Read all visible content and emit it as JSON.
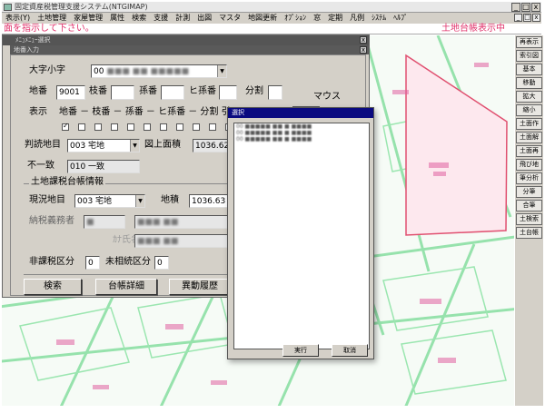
{
  "window": {
    "title": "固定資産税管理支援システム(NTGIMAP)"
  },
  "menu": [
    "表示(Y)",
    "土地管理",
    "家屋管理",
    "属性",
    "検索",
    "支援",
    "計測",
    "出図",
    "マスタ",
    "地図更新",
    "ｵﾌﾟｼｮﾝ",
    "窓",
    "定期",
    "凡例",
    "ｼｽﾃﾑ",
    "ﾍﾙﾌﾟ"
  ],
  "message": {
    "left": "面を指示して下さい。",
    "right": "土地台帳表示中"
  },
  "toolbar": [
    "再表示",
    "索引図",
    "基本",
    "移動",
    "拡大",
    "縮小",
    "土面作",
    "土面解",
    "土面再",
    "飛び地",
    "筆分析",
    "分筆",
    "合筆",
    "土検索",
    "土台帳"
  ],
  "dlg1": {
    "title1": "ﾒﾆｭﾒﾆｭｰ選択",
    "title2": "地番入力",
    "oaza_label": "大字小字",
    "oaza_value": "00",
    "chiban_label": "地番",
    "chiban_value": "9001",
    "edaban_label": "枝番",
    "magoban_label": "孫番",
    "hiban_label": "ヒ孫番",
    "bunkatsu_label": "分割",
    "mouse_label": "マウス",
    "hyoji_label": "表示",
    "hyoji_text": "地番 － 枝番 － 孫番 － ヒ孫番 － 分割 引",
    "hantei_label": "判読地目",
    "hantei_value": "003 宅地",
    "zujo_label": "図上面積",
    "zujo_value": "1036.62",
    "fuicchi_label": "不一致",
    "fuicchi_value": "010 一致",
    "group_label": "土地課税台帳情報",
    "genkyo_label": "現況地目",
    "genkyo_value": "003 宅地",
    "chiseki_label": "地積",
    "chiseki_value": "1036.63",
    "nozei_label": "納税義務者",
    "kana_label": "ｶﾅ氏名",
    "hikazei_label": "非課税区分",
    "hikazei_value": "0",
    "misokuzoku_label": "未相続区分",
    "misokuzoku_value": "0",
    "btn_search": "検索",
    "btn_detail": "台帳詳細",
    "btn_history": "異動履歴"
  },
  "dlg2": {
    "title": "選択",
    "ok": "実行",
    "cancel": "取消"
  }
}
